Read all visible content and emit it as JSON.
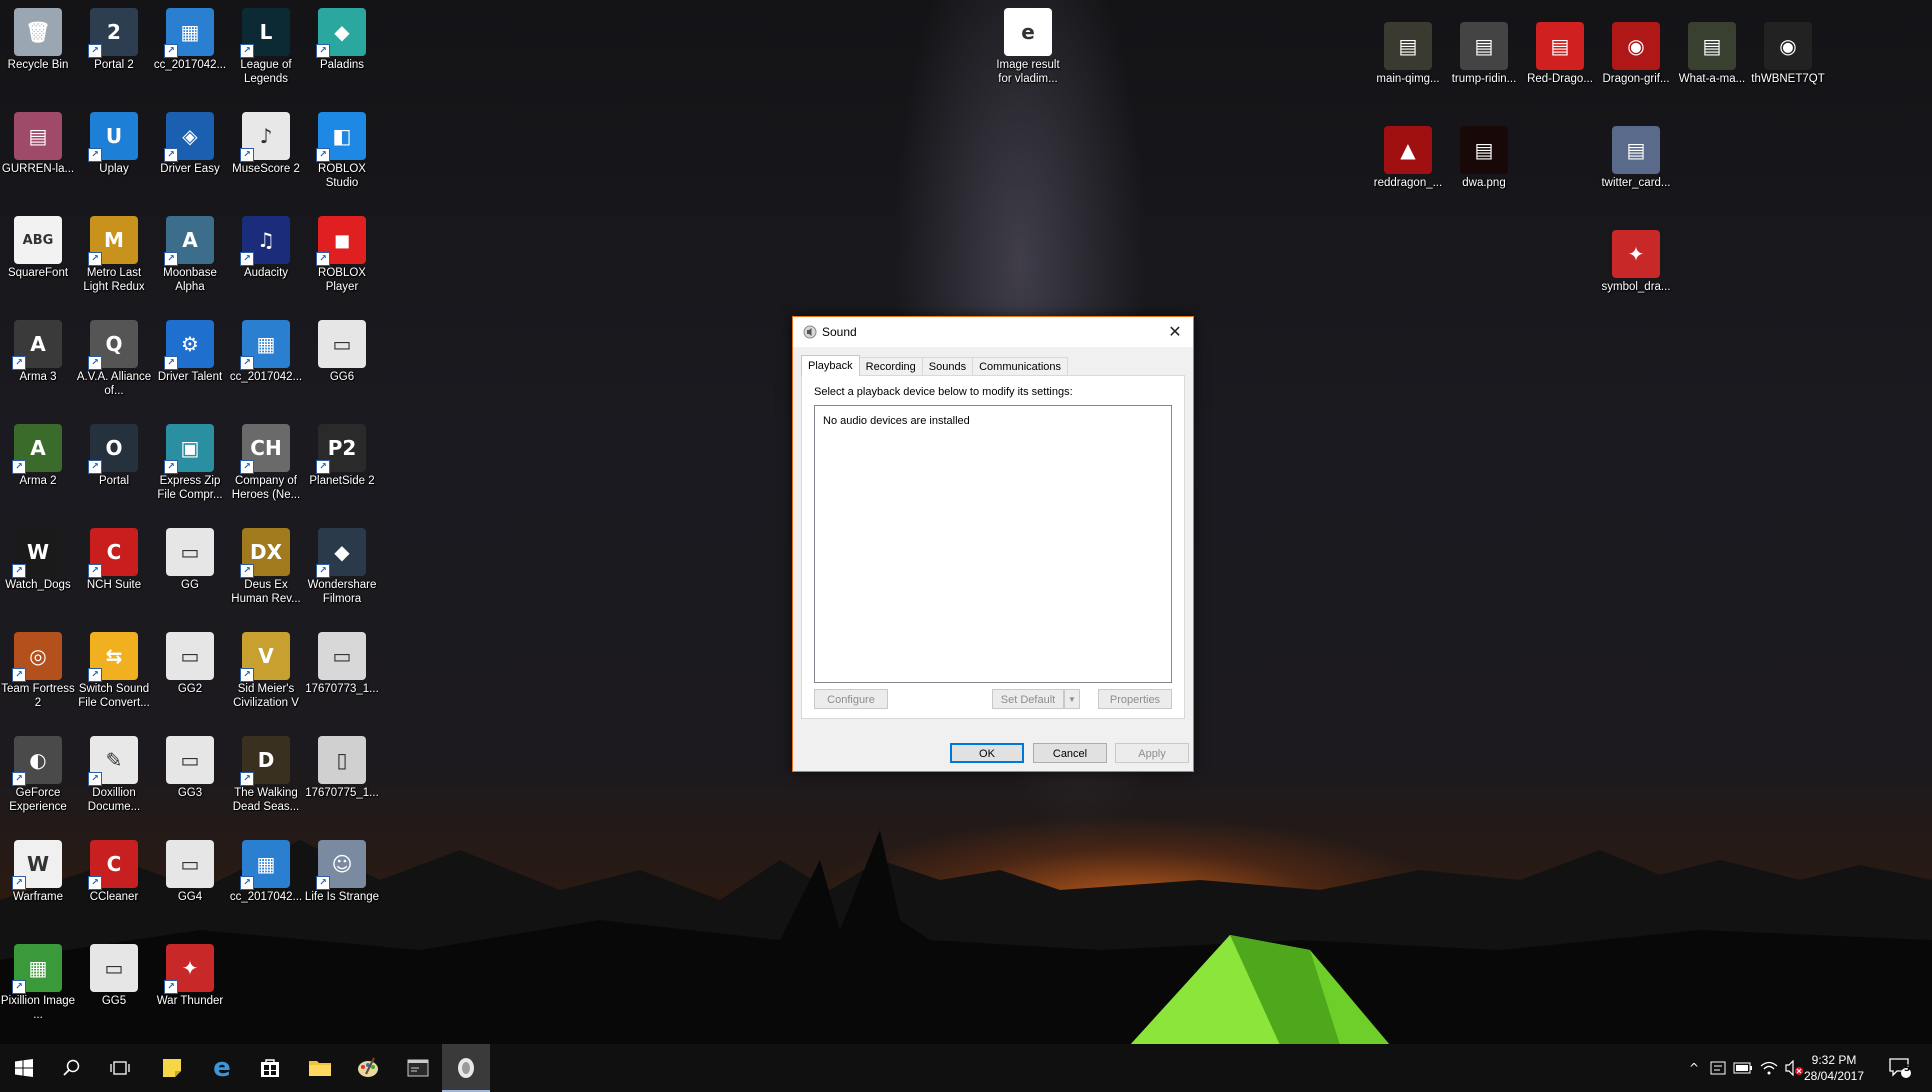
{
  "desktop_icons": [
    {
      "label": "Recycle Bin",
      "icon": "recycle-bin-icon",
      "color": "#9aa6b2",
      "glyph": "🗑",
      "shortcut": false
    },
    {
      "label": "Portal 2",
      "icon": "portal2-icon",
      "color": "#2d3e50",
      "glyph": "2",
      "shortcut": true
    },
    {
      "label": "cc_2017042...",
      "icon": "file-icon",
      "color": "#2a7fd0",
      "glyph": "▦",
      "shortcut": true
    },
    {
      "label": "League of Legends",
      "icon": "league-icon",
      "color": "#0b2a33",
      "glyph": "L",
      "shortcut": true
    },
    {
      "label": "Paladins",
      "icon": "paladins-icon",
      "color": "#2aa8a0",
      "glyph": "◆",
      "shortcut": true
    },
    {
      "label": "GURREN-la...",
      "icon": "image-file-icon",
      "color": "#a04a6a",
      "glyph": "▤",
      "shortcut": false
    },
    {
      "label": "Uplay",
      "icon": "uplay-icon",
      "color": "#1e7fd6",
      "glyph": "U",
      "shortcut": true
    },
    {
      "label": "Driver Easy",
      "icon": "driver-easy-icon",
      "color": "#1b5fb0",
      "glyph": "◈",
      "shortcut": true
    },
    {
      "label": "MuseScore 2",
      "icon": "musescore-icon",
      "color": "#e8e8e8",
      "glyph": "♪",
      "shortcut": true
    },
    {
      "label": "ROBLOX Studio",
      "icon": "roblox-studio-icon",
      "color": "#1e88e5",
      "glyph": "◧",
      "shortcut": true
    },
    {
      "label": "SquareFont",
      "icon": "squarefont-icon",
      "color": "#f2f2f2",
      "glyph": "ABG",
      "shortcut": false
    },
    {
      "label": "Metro Last Light Redux",
      "icon": "metro-icon",
      "color": "#c8921c",
      "glyph": "M",
      "shortcut": true
    },
    {
      "label": "Moonbase Alpha",
      "icon": "moonbase-icon",
      "color": "#3c6e8c",
      "glyph": "A",
      "shortcut": true
    },
    {
      "label": "Audacity",
      "icon": "audacity-icon",
      "color": "#1a2c7a",
      "glyph": "♫",
      "shortcut": true
    },
    {
      "label": "ROBLOX Player",
      "icon": "roblox-player-icon",
      "color": "#e02020",
      "glyph": "◼",
      "shortcut": true
    },
    {
      "label": "Arma 3",
      "icon": "arma3-icon",
      "color": "#3a3a3a",
      "glyph": "A",
      "shortcut": true
    },
    {
      "label": "A.V.A. Alliance of...",
      "icon": "ava-icon",
      "color": "#555",
      "glyph": "Q",
      "shortcut": true
    },
    {
      "label": "Driver Talent",
      "icon": "driver-talent-icon",
      "color": "#1f6fcf",
      "glyph": "⚙",
      "shortcut": true
    },
    {
      "label": "cc_2017042...",
      "icon": "file-icon",
      "color": "#2a7fd0",
      "glyph": "▦",
      "shortcut": true
    },
    {
      "label": "GG6",
      "icon": "image-file-icon",
      "color": "#e6e6e6",
      "glyph": "▭",
      "shortcut": false
    },
    {
      "label": "Arma 2",
      "icon": "arma2-icon",
      "color": "#3b6b2a",
      "glyph": "A",
      "shortcut": true
    },
    {
      "label": "Portal",
      "icon": "portal-icon",
      "color": "#25313d",
      "glyph": "O",
      "shortcut": true
    },
    {
      "label": "Express Zip File Compr...",
      "icon": "express-zip-icon",
      "color": "#2a8fa0",
      "glyph": "▣",
      "shortcut": true
    },
    {
      "label": "Company of Heroes (Ne...",
      "icon": "coh-icon",
      "color": "#6a6a6a",
      "glyph": "CH",
      "shortcut": true
    },
    {
      "label": "PlanetSide 2",
      "icon": "planetside-icon",
      "color": "#2a2a2a",
      "glyph": "P2",
      "shortcut": true
    },
    {
      "label": "Watch_Dogs",
      "icon": "watchdogs-icon",
      "color": "#1a1a1a",
      "glyph": "W",
      "shortcut": true
    },
    {
      "label": "NCH Suite",
      "icon": "nch-icon",
      "color": "#c81e1e",
      "glyph": "C",
      "shortcut": true
    },
    {
      "label": "GG",
      "icon": "image-file-icon",
      "color": "#e6e6e6",
      "glyph": "▭",
      "shortcut": false
    },
    {
      "label": "Deus Ex Human Rev...",
      "icon": "deusex-icon",
      "color": "#a07a1c",
      "glyph": "DX",
      "shortcut": true
    },
    {
      "label": "Wondershare Filmora",
      "icon": "filmora-icon",
      "color": "#2b3a4a",
      "glyph": "◆",
      "shortcut": true
    },
    {
      "label": "Team Fortress 2",
      "icon": "tf2-icon",
      "color": "#b4501c",
      "glyph": "◎",
      "shortcut": true
    },
    {
      "label": "Switch Sound File Convert...",
      "icon": "switch-icon",
      "color": "#f0b020",
      "glyph": "⇆",
      "shortcut": true
    },
    {
      "label": "GG2",
      "icon": "image-file-icon",
      "color": "#e6e6e6",
      "glyph": "▭",
      "shortcut": false
    },
    {
      "label": "Sid Meier's Civilization V",
      "icon": "civ5-icon",
      "color": "#c8a030",
      "glyph": "V",
      "shortcut": true
    },
    {
      "label": "17670773_1...",
      "icon": "image-file-icon",
      "color": "#d8d8d8",
      "glyph": "▭",
      "shortcut": false
    },
    {
      "label": "GeForce Experience",
      "icon": "geforce-icon",
      "color": "#4a4a4a",
      "glyph": "◐",
      "shortcut": true
    },
    {
      "label": "Doxillion Docume...",
      "icon": "doxillion-icon",
      "color": "#e8e8e8",
      "glyph": "✎",
      "shortcut": true
    },
    {
      "label": "GG3",
      "icon": "image-file-icon",
      "color": "#e6e6e6",
      "glyph": "▭",
      "shortcut": false
    },
    {
      "label": "The Walking Dead Seas...",
      "icon": "walkingdead-icon",
      "color": "#3a3020",
      "glyph": "D",
      "shortcut": true
    },
    {
      "label": "17670775_1...",
      "icon": "image-file-icon",
      "color": "#d0d0d0",
      "glyph": "▯",
      "shortcut": false
    },
    {
      "label": "Warframe",
      "icon": "warframe-icon",
      "color": "#f0f0f0",
      "glyph": "W",
      "shortcut": true
    },
    {
      "label": "CCleaner",
      "icon": "ccleaner-icon",
      "color": "#c82020",
      "glyph": "C",
      "shortcut": true
    },
    {
      "label": "GG4",
      "icon": "image-file-icon",
      "color": "#e6e6e6",
      "glyph": "▭",
      "shortcut": false
    },
    {
      "label": "cc_2017042...",
      "icon": "file-icon",
      "color": "#2a7fd0",
      "glyph": "▦",
      "shortcut": true
    },
    {
      "label": "Life Is Strange",
      "icon": "lifeisstrange-icon",
      "color": "#7a8aa0",
      "glyph": "☺",
      "shortcut": true
    },
    {
      "label": "Pixillion Image ...",
      "icon": "pixillion-icon",
      "color": "#3a9a3a",
      "glyph": "▦",
      "shortcut": true
    },
    {
      "label": "GG5",
      "icon": "image-file-icon",
      "color": "#e6e6e6",
      "glyph": "▭",
      "shortcut": false
    },
    {
      "label": "War Thunder",
      "icon": "warthunder-icon",
      "color": "#c82828",
      "glyph": "✦",
      "shortcut": true
    },
    {
      "label": "Image result for vladim...",
      "icon": "edge-file-icon",
      "color": "#ffffff",
      "glyph": "e",
      "shortcut": false
    },
    {
      "label": "main-qimg...",
      "icon": "image-file-icon",
      "color": "#3a3a30",
      "glyph": "▤",
      "shortcut": false
    },
    {
      "label": "trump-ridin...",
      "icon": "image-file-icon",
      "color": "#444",
      "glyph": "▤",
      "shortcut": false
    },
    {
      "label": "Red-Drago...",
      "icon": "image-file-icon",
      "color": "#d02020",
      "glyph": "▤",
      "shortcut": false
    },
    {
      "label": "Dragon-grif...",
      "icon": "image-file-icon",
      "color": "#b01818",
      "glyph": "◉",
      "shortcut": false
    },
    {
      "label": "What-a-ma...",
      "icon": "image-file-icon",
      "color": "#3a4030",
      "glyph": "▤",
      "shortcut": false
    },
    {
      "label": "thWBNET7QT",
      "icon": "image-file-icon",
      "color": "#222",
      "glyph": "◉",
      "shortcut": false
    },
    {
      "label": "reddragon_...",
      "icon": "image-file-icon",
      "color": "#a01010",
      "glyph": "▲",
      "shortcut": false
    },
    {
      "label": "dwa.png",
      "icon": "image-file-icon",
      "color": "#180808",
      "glyph": "▤",
      "shortcut": false
    },
    {
      "label": "twitter_card...",
      "icon": "image-file-icon",
      "color": "#5a6a8a",
      "glyph": "▤",
      "shortcut": false
    },
    {
      "label": "symbol_dra...",
      "icon": "image-file-icon",
      "color": "#c82828",
      "glyph": "✦",
      "shortcut": false
    }
  ],
  "dialog": {
    "title": "Sound",
    "tabs": [
      "Playback",
      "Recording",
      "Sounds",
      "Communications"
    ],
    "instruction": "Select a playback device below to modify its settings:",
    "device_message": "No audio devices are installed",
    "buttons": {
      "configure": "Configure",
      "set_default": "Set Default",
      "properties": "Properties",
      "ok": "OK",
      "cancel": "Cancel",
      "apply": "Apply"
    },
    "accent": "#e8731c"
  },
  "taskbar": {
    "time": "9:32 PM",
    "date": "28/04/2017",
    "notification_count": "5",
    "items": [
      "start",
      "search",
      "task-view",
      "sticky-notes",
      "edge",
      "store",
      "file-explorer",
      "paint",
      "media",
      "sound"
    ]
  }
}
